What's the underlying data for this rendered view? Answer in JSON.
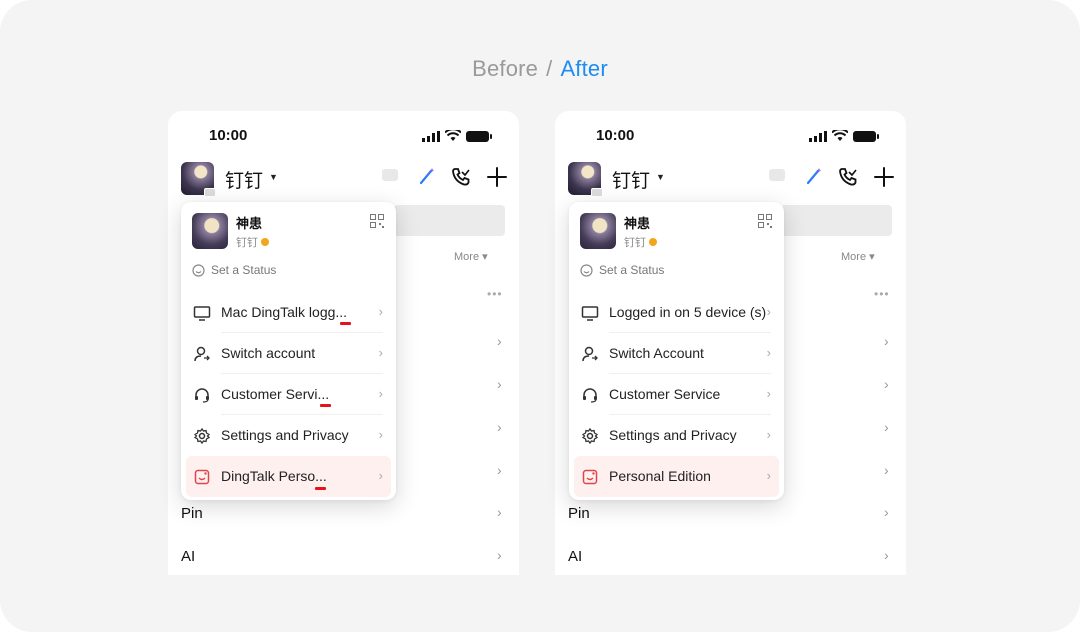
{
  "heading": {
    "before": "Before",
    "separator": "/",
    "after": "After"
  },
  "colors": {
    "accent": "#1e8cf0",
    "muted": "#9a9a9a",
    "highlight_row": "#fdf0ef",
    "error_mark": "#e5111b",
    "org_badge": "#f2a51d"
  },
  "status_bar": {
    "time": "10:00",
    "icons": [
      "signal-icon",
      "wifi-icon",
      "battery-icon"
    ]
  },
  "app_bar": {
    "title": "钉钉",
    "icons": [
      "chat-icon",
      "magic-wand-icon",
      "call-icon",
      "plus-icon"
    ]
  },
  "background_list": {
    "more_tab": "More",
    "rows": [
      "Pin",
      "AI"
    ]
  },
  "profile": {
    "name": "神患",
    "org": "钉钉",
    "status": "Set a Status"
  },
  "before": {
    "menu": [
      {
        "icon": "monitor-icon",
        "label": "Mac DingTalk logg..."
      },
      {
        "icon": "user-switch-icon",
        "label": "Switch account"
      },
      {
        "icon": "headset-icon",
        "label": "Customer Servi..."
      },
      {
        "icon": "gear-icon",
        "label": "Settings and Privacy"
      },
      {
        "icon": "personal-edition-icon",
        "label": "DingTalk Perso..."
      }
    ]
  },
  "after": {
    "menu": [
      {
        "icon": "monitor-icon",
        "label": "Logged in on 5 device (s)"
      },
      {
        "icon": "user-switch-icon",
        "label": "Switch Account"
      },
      {
        "icon": "headset-icon",
        "label": "Customer Service"
      },
      {
        "icon": "gear-icon",
        "label": "Settings and Privacy"
      },
      {
        "icon": "personal-edition-icon",
        "label": "Personal Edition"
      }
    ]
  }
}
